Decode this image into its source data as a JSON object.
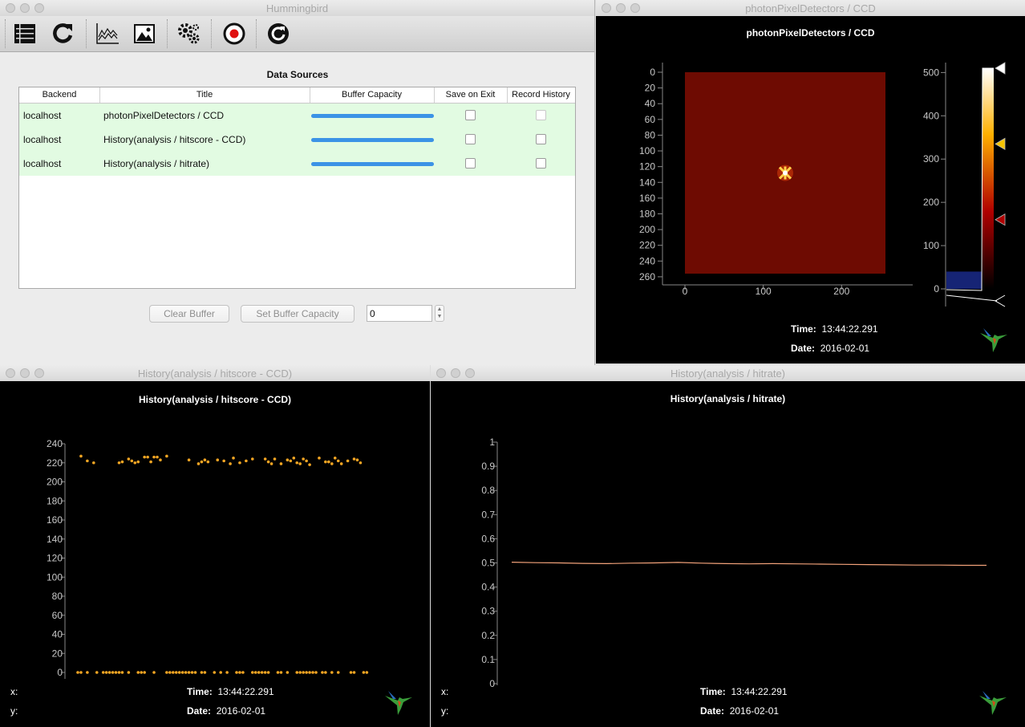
{
  "main": {
    "window_title": "Hummingbird",
    "toolbar": {
      "icons": [
        "data-sources-icon",
        "reload-icon",
        "line-plot-icon",
        "image-plot-icon",
        "settings-icon",
        "record-icon",
        "refresh-icon"
      ]
    },
    "table_title": "Data Sources",
    "columns": [
      "Backend",
      "Title",
      "Buffer Capacity",
      "Save on Exit",
      "Record History"
    ],
    "rows": [
      {
        "backend": "localhost",
        "title": "photonPixelDetectors / CCD",
        "buffer_fill": 1.0,
        "save_on_exit": false,
        "record_history": false,
        "record_enabled": false
      },
      {
        "backend": "localhost",
        "title": "History(analysis / hitscore - CCD)",
        "buffer_fill": 1.0,
        "save_on_exit": false,
        "record_history": false,
        "record_enabled": true
      },
      {
        "backend": "localhost",
        "title": "History(analysis / hitrate)",
        "buffer_fill": 1.0,
        "save_on_exit": false,
        "record_history": false,
        "record_enabled": true
      }
    ],
    "clear_buffer_label": "Clear Buffer",
    "set_buffer_label": "Set Buffer Capacity",
    "capacity_value": "0"
  },
  "ccd": {
    "window_title": "photonPixelDetectors / CCD",
    "plot_title": "photonPixelDetectors / CCD",
    "time_label": "Time:",
    "time_value": "13:44:22.291",
    "date_label": "Date:",
    "date_value": "2016-02-01"
  },
  "hitscore": {
    "window_title": "History(analysis / hitscore - CCD)",
    "plot_title": "History(analysis / hitscore - CCD)",
    "x_label": "x:",
    "y_label": "y:",
    "time_label": "Time:",
    "time_value": "13:44:22.291",
    "date_label": "Date:",
    "date_value": "2016-02-01"
  },
  "hitrate": {
    "window_title": "History(analysis / hitrate)",
    "plot_title": "History(analysis / hitrate)",
    "x_label": "x:",
    "y_label": "y:",
    "time_label": "Time:",
    "time_value": "13:44:22.291",
    "date_label": "Date:",
    "date_value": "2016-02-01"
  },
  "colors": {
    "accent_bar": "#3b93e6",
    "row_bg": "#e2fbe2",
    "point": "#f5a623",
    "line": "#f2a27a",
    "image_bg": "#6e0b02"
  },
  "chart_data": [
    {
      "type": "heatmap",
      "title": "photonPixelDetectors / CCD",
      "x_ticks": [
        0,
        100,
        200
      ],
      "y_ticks": [
        0,
        20,
        40,
        60,
        80,
        100,
        120,
        140,
        160,
        180,
        200,
        220,
        240,
        260
      ],
      "xlim": [
        0,
        256
      ],
      "ylim": [
        0,
        256
      ],
      "hotspot": [
        128,
        128
      ],
      "colorbar": {
        "ticks": [
          0,
          100,
          200,
          300,
          400,
          500
        ],
        "range": [
          0,
          510
        ],
        "markers": [
          510,
          335,
          160
        ]
      }
    },
    {
      "type": "scatter",
      "title": "History(analysis / hitscore - CCD)",
      "ylim": [
        0,
        240
      ],
      "y_ticks": [
        240,
        220,
        200,
        180,
        160,
        140,
        120,
        100,
        80,
        60,
        40,
        20,
        0
      ],
      "xlim": [
        0,
        100
      ],
      "points_high": [
        [
          1,
          227
        ],
        [
          3,
          222
        ],
        [
          5,
          220
        ],
        [
          13,
          220
        ],
        [
          14,
          221
        ],
        [
          16,
          224
        ],
        [
          17,
          222
        ],
        [
          18,
          220
        ],
        [
          19,
          221
        ],
        [
          21,
          226
        ],
        [
          22,
          226
        ],
        [
          23,
          221
        ],
        [
          24,
          226
        ],
        [
          25,
          226
        ],
        [
          26,
          223
        ],
        [
          28,
          227
        ],
        [
          35,
          223
        ],
        [
          38,
          219
        ],
        [
          39,
          221
        ],
        [
          40,
          223
        ],
        [
          41,
          221
        ],
        [
          44,
          223
        ],
        [
          46,
          222
        ],
        [
          48,
          219
        ],
        [
          49,
          225
        ],
        [
          51,
          220
        ],
        [
          53,
          222
        ],
        [
          55,
          224
        ],
        [
          59,
          224
        ],
        [
          60,
          221
        ],
        [
          61,
          219
        ],
        [
          62,
          224
        ],
        [
          64,
          219
        ],
        [
          66,
          223
        ],
        [
          67,
          222
        ],
        [
          68,
          225
        ],
        [
          69,
          220
        ],
        [
          70,
          219
        ],
        [
          71,
          224
        ],
        [
          72,
          222
        ],
        [
          73,
          218
        ],
        [
          76,
          225
        ],
        [
          78,
          221
        ],
        [
          79,
          221
        ],
        [
          80,
          219
        ],
        [
          81,
          225
        ],
        [
          82,
          222
        ],
        [
          83,
          219
        ],
        [
          85,
          222
        ],
        [
          87,
          224
        ],
        [
          88,
          223
        ],
        [
          89,
          220
        ]
      ],
      "points_zero": [
        0,
        1,
        3,
        6,
        8,
        9,
        10,
        11,
        12,
        13,
        14,
        16,
        19,
        20,
        21,
        24,
        28,
        29,
        30,
        31,
        32,
        33,
        34,
        35,
        36,
        37,
        39,
        40,
        43,
        45,
        47,
        50,
        51,
        52,
        55,
        56,
        57,
        58,
        59,
        60,
        63,
        64,
        66,
        69,
        70,
        71,
        72,
        73,
        74,
        75,
        77,
        78,
        80,
        82,
        86,
        87,
        90,
        91
      ]
    },
    {
      "type": "line",
      "title": "History(analysis / hitrate)",
      "ylim": [
        0,
        1.0
      ],
      "y_ticks": [
        1.0,
        0.9,
        0.8,
        0.7,
        0.6,
        0.5,
        0.4,
        0.3,
        0.2,
        0.1,
        0
      ],
      "xlim": [
        0,
        100
      ],
      "x": [
        0,
        5,
        10,
        15,
        20,
        25,
        30,
        35,
        40,
        45,
        50,
        55,
        60,
        65,
        70,
        75,
        80,
        85,
        90,
        95,
        100
      ],
      "values": [
        0.503,
        0.501,
        0.5,
        0.498,
        0.497,
        0.499,
        0.5,
        0.502,
        0.499,
        0.497,
        0.496,
        0.497,
        0.496,
        0.495,
        0.494,
        0.493,
        0.492,
        0.491,
        0.491,
        0.49,
        0.49
      ]
    }
  ]
}
